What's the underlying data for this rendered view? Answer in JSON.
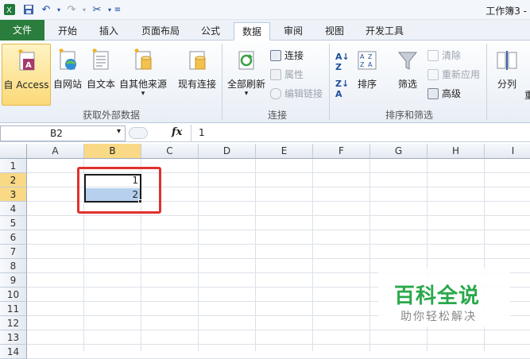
{
  "window": {
    "title": "工作簿3 -"
  },
  "quick_access": {
    "icons": [
      "excel-logo-icon",
      "save-icon",
      "undo-icon",
      "redo-icon",
      "tools-icon",
      "customize-icon"
    ]
  },
  "tabs": [
    {
      "label": "文件",
      "active": false
    },
    {
      "label": "开始",
      "active": false
    },
    {
      "label": "插入",
      "active": false
    },
    {
      "label": "页面布局",
      "active": false
    },
    {
      "label": "公式",
      "active": false
    },
    {
      "label": "数据",
      "active": true
    },
    {
      "label": "审阅",
      "active": false
    },
    {
      "label": "视图",
      "active": false
    },
    {
      "label": "开发工具",
      "active": false
    }
  ],
  "ribbon": {
    "get_external": {
      "group_label": "获取外部数据",
      "access": "自 Access",
      "web": "自网站",
      "text": "自文本",
      "other": "自其他来源",
      "existing": "现有连接"
    },
    "connections": {
      "group_label": "连接",
      "refresh_all": "全部刷新",
      "connections": "连接",
      "properties": "属性",
      "edit_links": "编辑链接"
    },
    "sort_filter": {
      "group_label": "排序和筛选",
      "sort": "排序",
      "filter": "筛选",
      "clear": "清除",
      "reapply": "重新应用",
      "advanced": "高级"
    },
    "data_tools": {
      "split": "分列",
      "partial": "重"
    }
  },
  "formula_bar": {
    "name_box": "B2",
    "fx_label": "fx",
    "value": "1"
  },
  "grid": {
    "columns": [
      "A",
      "B",
      "C",
      "D",
      "E",
      "F",
      "G",
      "H",
      "I"
    ],
    "rows": [
      "1",
      "2",
      "3",
      "4",
      "5",
      "6",
      "7",
      "8",
      "9",
      "10",
      "11",
      "12",
      "13",
      "14"
    ],
    "cells": {
      "B2": "1",
      "B3": "2"
    },
    "selected_range": "B2:B3",
    "highlight_color": "#e0312d"
  },
  "watermark": {
    "title": "百科全说",
    "subtitle": "助你轻松解决"
  }
}
